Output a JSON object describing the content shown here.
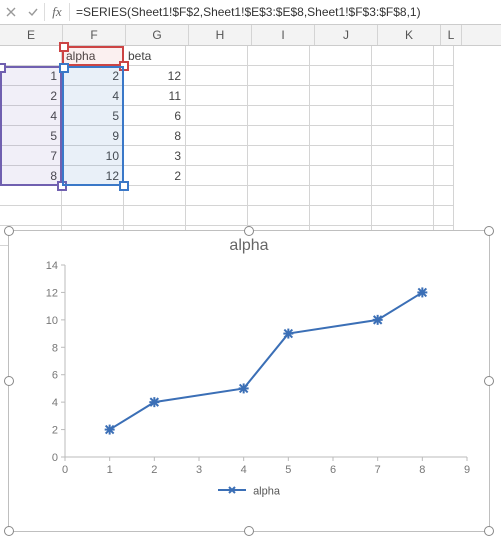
{
  "formula_bar": {
    "fx_label": "fx",
    "formula": "=SERIES(Sheet1!$F$2,Sheet1!$E$3:$E$8,Sheet1!$F$3:$F$8,1)"
  },
  "columns": [
    "E",
    "F",
    "G",
    "H",
    "I",
    "J",
    "K",
    "L"
  ],
  "header": {
    "F": "alpha",
    "G": "beta"
  },
  "table": {
    "E": [
      "1",
      "2",
      "4",
      "5",
      "7",
      "8"
    ],
    "F": [
      "2",
      "4",
      "5",
      "9",
      "10",
      "12"
    ],
    "G": [
      "12",
      "11",
      "6",
      "8",
      "3",
      "2"
    ]
  },
  "chart": {
    "title": "alpha",
    "legend_label": "alpha",
    "x_ticks": [
      "0",
      "1",
      "2",
      "3",
      "4",
      "5",
      "6",
      "7",
      "8",
      "9"
    ],
    "y_ticks": [
      "0",
      "2",
      "4",
      "6",
      "8",
      "10",
      "12",
      "14"
    ]
  },
  "chart_data": {
    "type": "line",
    "title": "alpha",
    "xlabel": "",
    "ylabel": "",
    "xlim": [
      0,
      9
    ],
    "ylim": [
      0,
      14
    ],
    "x": [
      1,
      2,
      4,
      5,
      7,
      8
    ],
    "series": [
      {
        "name": "alpha",
        "values": [
          2,
          4,
          5,
          9,
          10,
          12
        ]
      }
    ],
    "legend_position": "bottom",
    "grid": false,
    "markers": true
  }
}
